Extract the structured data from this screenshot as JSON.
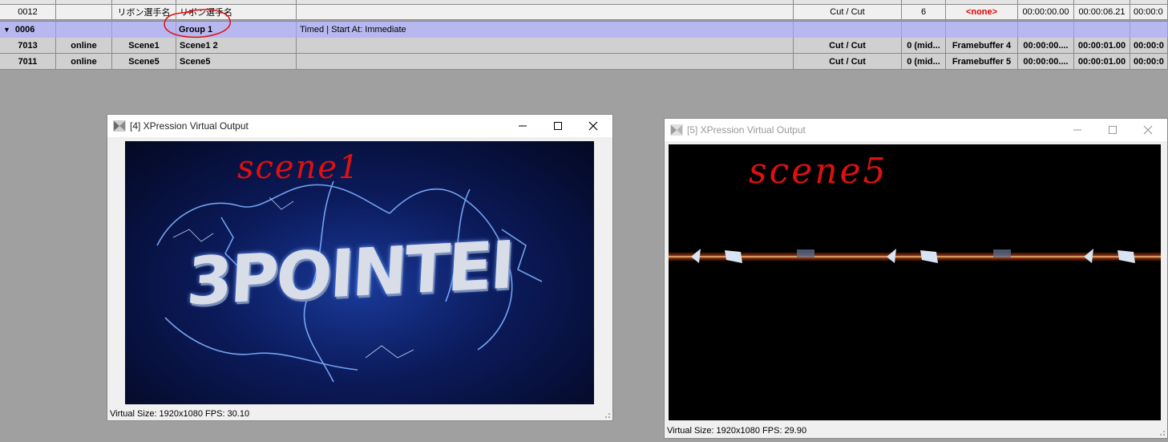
{
  "grid": {
    "row_partial": {
      "id": "0012",
      "name": "リボン選手名",
      "scene": "リボン選手名",
      "transition": "Cut / Cut",
      "layer": "6",
      "framebuffer": "<none>",
      "time1": "00:00:00.00",
      "time2": "00:00:06.21",
      "time3": "00:00:0"
    },
    "row_group": {
      "id": "0006",
      "scene": "Group 1",
      "description": "Timed | Start At: Immediate"
    },
    "rows": [
      {
        "id": "7013",
        "status": "online",
        "name": "Scene1",
        "scene": "Scene1 2",
        "transition": "Cut / Cut",
        "layer": "0 (mid...",
        "framebuffer": "Framebuffer 4",
        "time1": "00:00:00....",
        "time2": "00:00:01.00",
        "time3": "00:00:0"
      },
      {
        "id": "7011",
        "status": "online",
        "name": "Scene5",
        "scene": "Scene5",
        "transition": "Cut / Cut",
        "layer": "0 (mid...",
        "framebuffer": "Framebuffer 5",
        "time1": "00:00:00....",
        "time2": "00:00:01.00",
        "time3": "00:00:0"
      }
    ]
  },
  "windows": [
    {
      "title": "[4] XPression Virtual Output",
      "status": "Virtual Size: 1920x1080  FPS: 30.10",
      "annotation": "scene1",
      "logo_text": "3POINTEI"
    },
    {
      "title": "[5] XPression Virtual Output",
      "status": "Virtual Size: 1920x1080  FPS: 29.90",
      "annotation": "scene5"
    }
  ],
  "colors": {
    "group_row": "#b8b8f0",
    "none_text": "#e00000",
    "annotation_ink": "#e01010",
    "desktop": "#a0a0a0"
  },
  "icons": [
    "app-icon",
    "minimize-icon",
    "maximize-icon",
    "close-icon",
    "expand-triangle-icon",
    "resize-grip-icon"
  ]
}
